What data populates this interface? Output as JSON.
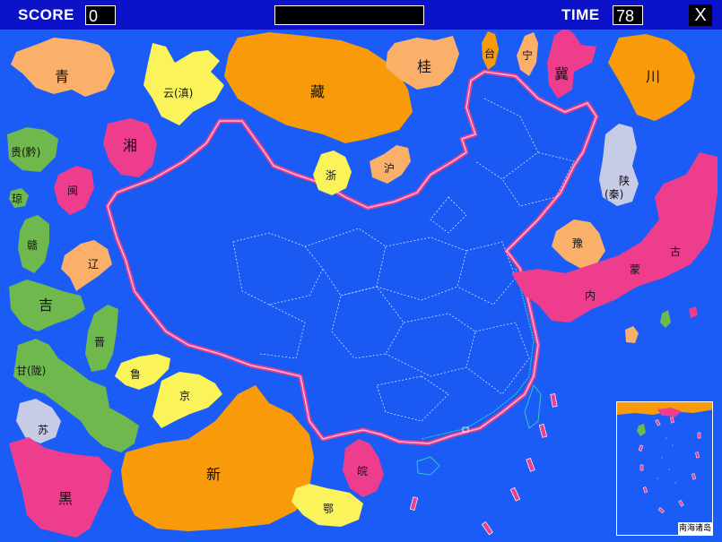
{
  "hud": {
    "score_label": "SCORE",
    "score_value": "0",
    "time_label": "TIME",
    "time_value": "78",
    "close_label": "X",
    "message": ""
  },
  "pieces": {
    "qing": "青",
    "yun": "云(滇)",
    "zang": "藏",
    "gui_guangxi": "桂",
    "tai": "台",
    "ning": "宁",
    "ji_hebei": "冀",
    "chuan": "川",
    "gui_guizhou": "贵(黔)",
    "xiang": "湘",
    "zhe": "浙",
    "hu": "沪",
    "shaan": "陕",
    "shaan_alt": "(秦)",
    "min": "闽",
    "qiong": "琼",
    "gan_jiangxi": "赣",
    "liao": "辽",
    "yu": "豫",
    "nei": "内",
    "meng": "蒙",
    "gu": "古",
    "ji_jilin": "吉",
    "jin": "晋",
    "gan_gansu": "甘(陇)",
    "lu": "鲁",
    "jing": "京",
    "su": "苏",
    "xin": "新",
    "wan": "皖",
    "hei": "黑",
    "e": "鄂"
  },
  "inset": {
    "label": "南海诸岛"
  },
  "colors": {
    "sea": "#1b5cf6",
    "bar": "#0b12c8",
    "orange": "#f89a0a",
    "light_orange": "#fbb06a",
    "pink": "#ef3d8e",
    "yellow": "#fbf35a",
    "green": "#6fb84e",
    "lilac": "#c7cbe6",
    "border": "#e0408e"
  }
}
